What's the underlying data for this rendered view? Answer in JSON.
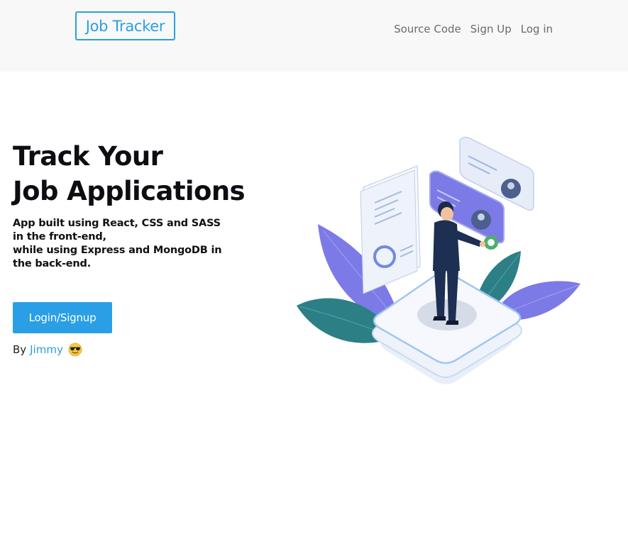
{
  "navbar": {
    "logo_text": "Job Tracker",
    "links": [
      {
        "label": "Source Code"
      },
      {
        "label": "Sign Up"
      },
      {
        "label": "Log in"
      }
    ]
  },
  "hero": {
    "title_lines": [
      "Track Your",
      "Job Applications"
    ],
    "description_lines": [
      "App built using React, CSS and SASS",
      "in the front-end,",
      "while using Express and MongoDB in",
      "the back-end."
    ],
    "cta_label": "Login/Signup",
    "byline_prefix": "By",
    "author": "Jimmy",
    "author_emoji": "sunglasses-face-icon"
  },
  "colors": {
    "accent": "#2a9fe6",
    "navbar_bg": "#f8f8f8",
    "leaf_purple": "#7c7ae6",
    "leaf_teal": "#2d7f86"
  }
}
